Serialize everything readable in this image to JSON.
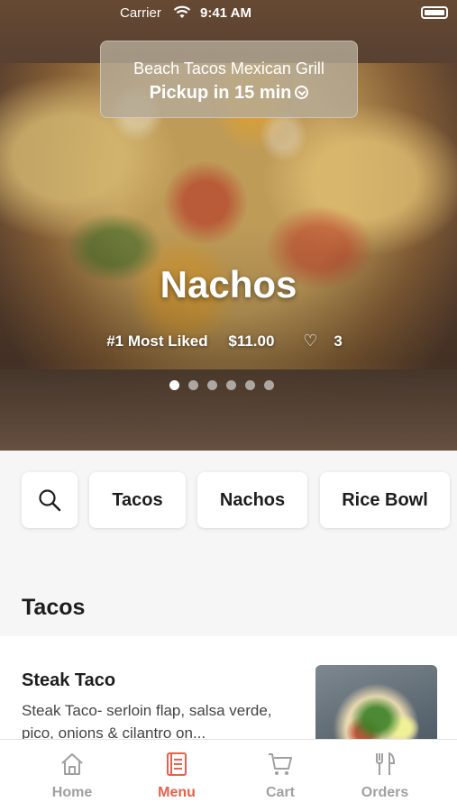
{
  "status_bar": {
    "carrier": "Carrier",
    "time": "9:41 AM"
  },
  "restaurant": {
    "name": "Beach Tacos Mexican Grill",
    "pickup": "Pickup in 15 min"
  },
  "featured": {
    "title": "Nachos",
    "badge": "#1 Most Liked",
    "price": "$11.00",
    "likes": "3",
    "carousel": {
      "count": 6,
      "active_index": 0
    }
  },
  "categories": {
    "items": [
      "Tacos",
      "Nachos",
      "Rice Bowl"
    ]
  },
  "section": {
    "title": "Tacos"
  },
  "menu_items": [
    {
      "name": "Steak Taco",
      "description": "Steak Taco- serloin flap, salsa verde, pico, onions & cilantro on..."
    }
  ],
  "tabbar": {
    "items": [
      {
        "label": "Home",
        "icon": "home-icon"
      },
      {
        "label": "Menu",
        "icon": "menu-icon"
      },
      {
        "label": "Cart",
        "icon": "cart-icon"
      },
      {
        "label": "Orders",
        "icon": "utensils-icon"
      }
    ],
    "active": "Menu"
  },
  "colors": {
    "accent": "#e8604a",
    "inactive": "#a0a0a0"
  }
}
